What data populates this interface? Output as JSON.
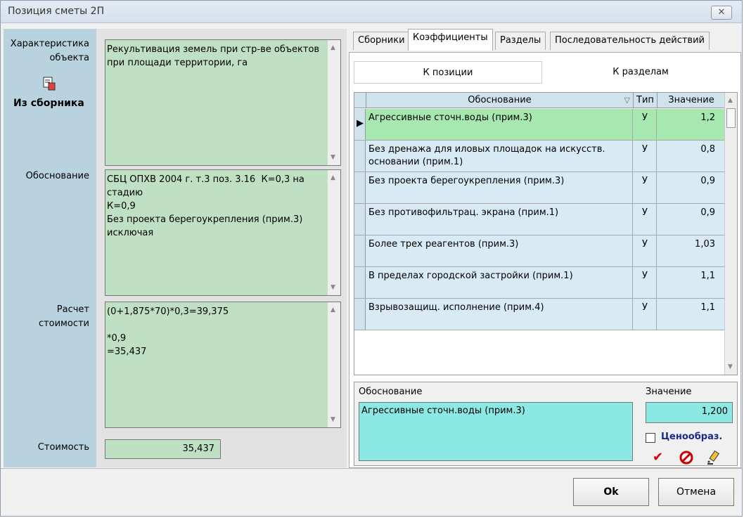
{
  "window": {
    "title": "Позиция сметы 2П",
    "close_glyph": "✕"
  },
  "left": {
    "characteristic_label": "Характеристика\nобъекта",
    "source_label": "Из сборника",
    "justification_label": "Обоснование",
    "calc_label": "Расчет\nстоимости",
    "cost_label": "Стоимость"
  },
  "memos": {
    "characteristic": "Рекультивация земель при стр-ве объектов\nпри площади территории, га",
    "justification": "СБЦ ОПХВ 2004 г. т.3 поз. 3.16  К=0,3 на\nстадию\nК=0,9\nБез проекта берегоукрепления (прим.3)\nисключая",
    "calculation": "(0+1,875*70)*0,3=39,375\n\n*0,9\n=35,437",
    "cost": "35,437"
  },
  "tabs": [
    "Сборники",
    "Коэффициенты",
    "Разделы",
    "Последовательность действий"
  ],
  "active_tab": "Коэффициенты",
  "subtabs": {
    "position": "К позиции",
    "sections": "К разделам"
  },
  "grid": {
    "headers": {
      "name": "Обоснование",
      "type": "Тип",
      "value": "Значение"
    },
    "rows": [
      {
        "name": "Агрессивные сточн.воды (прим.3)",
        "type": "У",
        "value": "1,2"
      },
      {
        "name": "Без дренажа для иловых площадок на искусств. основании (прим.1)",
        "type": "У",
        "value": "0,8"
      },
      {
        "name": "Без проекта берегоукрепления (прим.3)",
        "type": "У",
        "value": "0,9"
      },
      {
        "name": "Без противофильтрац. экрана (прим.1)",
        "type": "У",
        "value": "0,9"
      },
      {
        "name": "Более трех реагентов (прим.3)",
        "type": "У",
        "value": "1,03"
      },
      {
        "name": "В пределах городской застройки (прим.1)",
        "type": "У",
        "value": "1,1"
      },
      {
        "name": "Взрывозащищ. исполнение (прим.4)",
        "type": "У",
        "value": "1,1"
      }
    ]
  },
  "detail": {
    "justification_label": "Обоснование",
    "justification_value": "Агрессивные сточн.воды (прим.3)",
    "value_label": "Значение",
    "value": "1,200",
    "pricing_label": "Ценообраз."
  },
  "buttons": {
    "ok": "Ok",
    "cancel": "Отмена"
  },
  "colors": {
    "memo_bg": "#bfe0c2",
    "left_panel": "#b8d2df",
    "selected_row": "#a6e8b0",
    "grid_row": "#d8eaf4",
    "detail_bg": "#8ce8e3"
  }
}
